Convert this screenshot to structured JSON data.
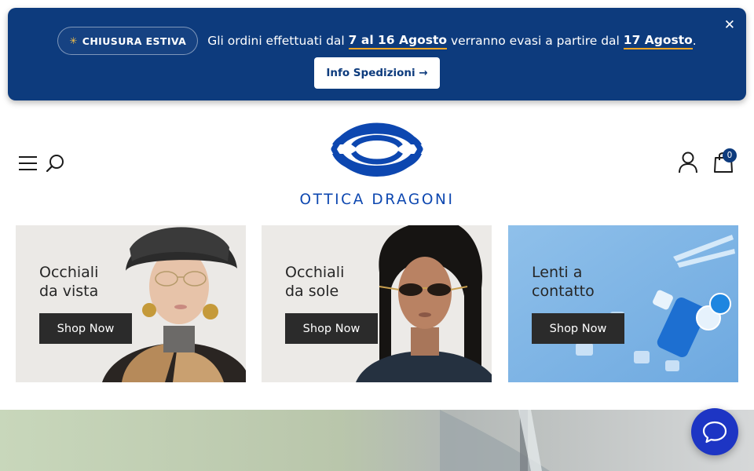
{
  "announcement": {
    "badge": "CHIUSURA ESTIVA",
    "text_before": "Gli ordini effettuati dal ",
    "highlight_dates": "7 al 16 Agosto",
    "text_middle": " verranno evasi a partire dal ",
    "highlight_resume": "17 Agosto",
    "text_after": ".",
    "button_label": "Info Spedizioni →",
    "close_symbol": "✕"
  },
  "header": {
    "logo_text": "OTTICA DRAGONI",
    "cart_count": "0"
  },
  "categories": [
    {
      "title_line1": "Occhiali",
      "title_line2": "da vista",
      "button": "Shop Now"
    },
    {
      "title_line1": "Occhiali",
      "title_line2": "da sole",
      "button": "Shop Now"
    },
    {
      "title_line1": "Lenti a",
      "title_line2": "contatto",
      "button": "Shop Now"
    }
  ],
  "icons": {
    "menu": "hamburger-menu-icon",
    "search": "search-icon",
    "account": "user-icon",
    "cart": "shopping-bag-icon",
    "chat": "chat-bubble-icon",
    "close": "close-icon"
  },
  "colors": {
    "announcement_bg": "#0d3b7d",
    "highlight_underline": "#f5a623",
    "brand_blue": "#0d47b0",
    "shop_button": "#2b2b2b",
    "chat_button": "#1d35c4"
  }
}
